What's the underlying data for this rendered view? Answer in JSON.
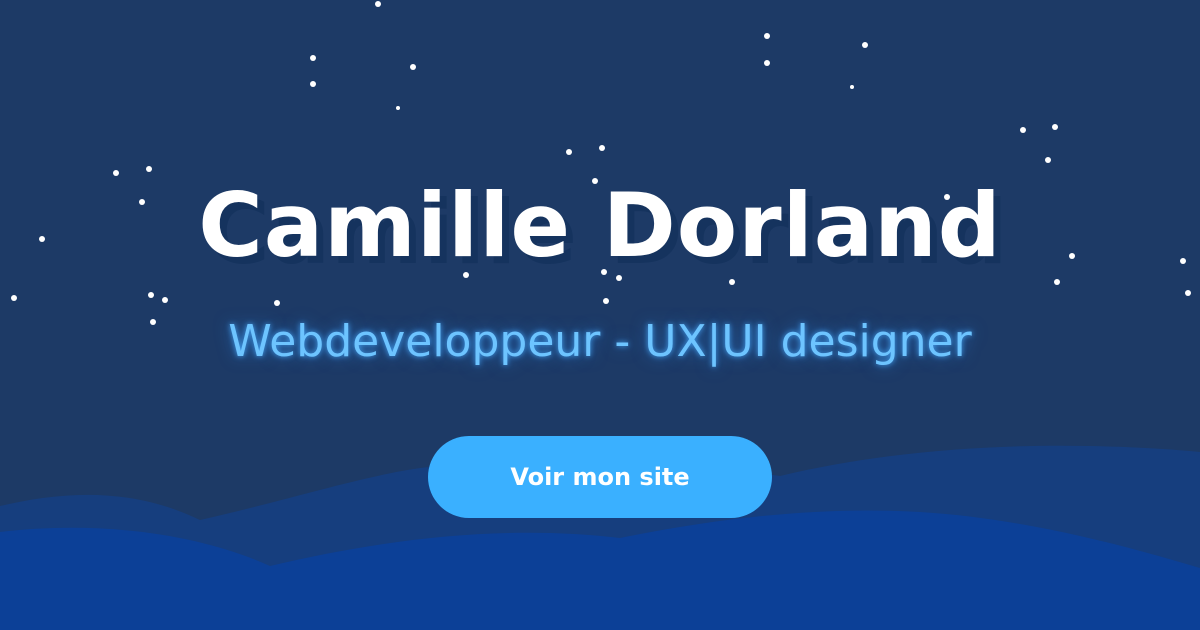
{
  "banner": {
    "title": "Camille Dorland",
    "subtitle": "Webdeveloppeur - UX|UI designer",
    "cta_label": "Voir mon site"
  },
  "colors": {
    "background": "#1d3a66",
    "title": "#ffffff",
    "subtitle_glow": "#6dc4ff",
    "button": "#3ab0ff",
    "hill_back": "#163e7e",
    "hill_front": "#0c4097"
  }
}
